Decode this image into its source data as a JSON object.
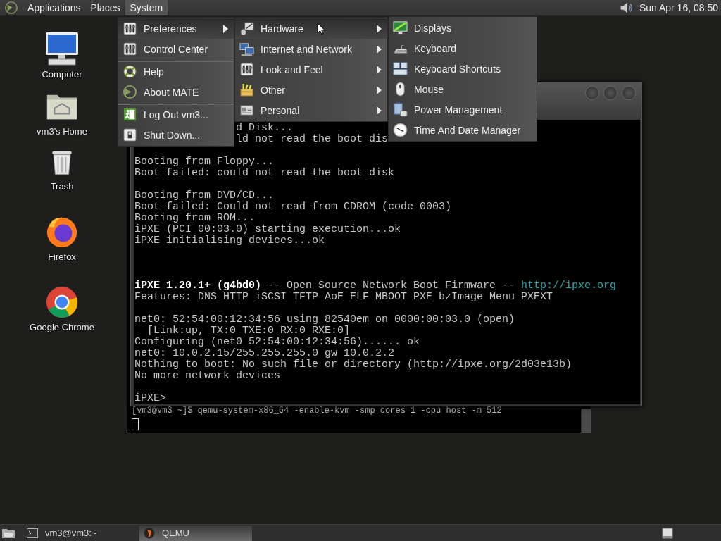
{
  "top_panel": {
    "menus": [
      {
        "label": "Applications",
        "selected": false
      },
      {
        "label": "Places",
        "selected": false
      },
      {
        "label": "System",
        "selected": true
      }
    ],
    "clock": "Sun Apr 16, 08:50"
  },
  "desktop_icons": [
    {
      "label": "Computer"
    },
    {
      "label": "vm3's Home"
    },
    {
      "label": "Trash"
    },
    {
      "label": "Firefox"
    },
    {
      "label": "Google Chrome"
    }
  ],
  "terminal_window": {
    "lines": [
      "[vm3@vm3 ~]$ qemu-system-x86_64 -enable-kvm -smp cores=1 -cpu host -m 512"
    ]
  },
  "qemu_window": {
    "screen_lines": [
      {
        "kind": "partial",
        "parts": [
          {
            "text": "d Disk...",
            "kind": "normal"
          }
        ]
      },
      {
        "kind": "partial",
        "parts": [
          {
            "text": "ld not read the boot dis",
            "kind": "normal"
          }
        ]
      },
      {
        "kind": "blank"
      },
      {
        "kind": "text",
        "parts": [
          {
            "text": "Booting from Floppy...",
            "kind": "normal"
          }
        ]
      },
      {
        "kind": "text",
        "parts": [
          {
            "text": "Boot failed: could not read the boot disk",
            "kind": "normal"
          }
        ]
      },
      {
        "kind": "blank"
      },
      {
        "kind": "text",
        "parts": [
          {
            "text": "Booting from DVD/CD...",
            "kind": "normal"
          }
        ]
      },
      {
        "kind": "text",
        "parts": [
          {
            "text": "Boot failed: Could not read from CDROM (code 0003)",
            "kind": "normal"
          }
        ]
      },
      {
        "kind": "text",
        "parts": [
          {
            "text": "Booting from ROM...",
            "kind": "normal"
          }
        ]
      },
      {
        "kind": "text",
        "parts": [
          {
            "text": "iPXE (PCI 00:03.0) starting execution...ok",
            "kind": "normal"
          }
        ]
      },
      {
        "kind": "text",
        "parts": [
          {
            "text": "iPXE initialising devices...ok",
            "kind": "normal"
          }
        ]
      },
      {
        "kind": "blank"
      },
      {
        "kind": "blank"
      },
      {
        "kind": "blank"
      },
      {
        "kind": "text",
        "parts": [
          {
            "text": "iPXE 1.20.1+ (g4bd0)",
            "kind": "bright"
          },
          {
            "text": " -- Open Source Network Boot Firmware -- ",
            "kind": "normal"
          },
          {
            "text": "http://ipxe.org",
            "kind": "link"
          }
        ]
      },
      {
        "kind": "text",
        "parts": [
          {
            "text": "Features: DNS HTTP iSCSI TFTP AoE ELF MBOOT PXE bzImage Menu PXEXT",
            "kind": "normal"
          }
        ]
      },
      {
        "kind": "blank"
      },
      {
        "kind": "text",
        "parts": [
          {
            "text": "net0: 52:54:00:12:34:56 using 82540em on 0000:00:03.0 (open)",
            "kind": "normal"
          }
        ]
      },
      {
        "kind": "text",
        "parts": [
          {
            "text": "  [Link:up, TX:0 TXE:0 RX:0 RXE:0]",
            "kind": "normal"
          }
        ]
      },
      {
        "kind": "text",
        "parts": [
          {
            "text": "Configuring (net0 52:54:00:12:34:56)...... ok",
            "kind": "normal"
          }
        ]
      },
      {
        "kind": "text",
        "parts": [
          {
            "text": "net0: 10.0.2.15/255.255.255.0 gw 10.0.2.2",
            "kind": "normal"
          }
        ]
      },
      {
        "kind": "text",
        "parts": [
          {
            "text": "Nothing to boot: No such file or directory (http://ipxe.org/2d03e13b)",
            "kind": "normal"
          }
        ]
      },
      {
        "kind": "text",
        "parts": [
          {
            "text": "No more network devices",
            "kind": "normal"
          }
        ]
      },
      {
        "kind": "blank"
      },
      {
        "kind": "text",
        "parts": [
          {
            "text": "iPXE>",
            "kind": "normal"
          }
        ]
      }
    ]
  },
  "menus": [
    {
      "items": [
        {
          "label": "Preferences",
          "highlighted": true,
          "submenu": true,
          "separator_before": false
        },
        {
          "label": "Control Center",
          "highlighted": false,
          "submenu": false,
          "separator_before": false
        },
        {
          "label": "Help",
          "highlighted": false,
          "submenu": false,
          "separator_before": true
        },
        {
          "label": "About MATE",
          "highlighted": false,
          "submenu": false,
          "separator_before": false
        },
        {
          "label": "Log Out vm3...",
          "highlighted": false,
          "submenu": false,
          "separator_before": true
        },
        {
          "label": "Shut Down...",
          "highlighted": false,
          "submenu": false,
          "separator_before": false
        }
      ]
    },
    {
      "items": [
        {
          "label": "Hardware",
          "highlighted": true,
          "submenu": true,
          "separator_before": false
        },
        {
          "label": "Internet and Network",
          "highlighted": false,
          "submenu": true,
          "separator_before": false
        },
        {
          "label": "Look and Feel",
          "highlighted": false,
          "submenu": true,
          "separator_before": false
        },
        {
          "label": "Other",
          "highlighted": false,
          "submenu": true,
          "separator_before": false
        },
        {
          "label": "Personal",
          "highlighted": false,
          "submenu": true,
          "separator_before": false
        }
      ]
    },
    {
      "items": [
        {
          "label": "Displays",
          "highlighted": false,
          "submenu": false,
          "separator_before": false
        },
        {
          "label": "Keyboard",
          "highlighted": false,
          "submenu": false,
          "separator_before": false
        },
        {
          "label": "Keyboard Shortcuts",
          "highlighted": false,
          "submenu": false,
          "separator_before": false
        },
        {
          "label": "Mouse",
          "highlighted": false,
          "submenu": false,
          "separator_before": false
        },
        {
          "label": "Power Management",
          "highlighted": false,
          "submenu": false,
          "separator_before": false
        },
        {
          "label": "Time And Date Manager",
          "highlighted": false,
          "submenu": false,
          "separator_before": false
        }
      ]
    }
  ],
  "taskbar": {
    "tasks": [
      {
        "label": "vm3@vm3:~",
        "selected": false
      },
      {
        "label": "QEMU",
        "selected": true
      }
    ]
  }
}
